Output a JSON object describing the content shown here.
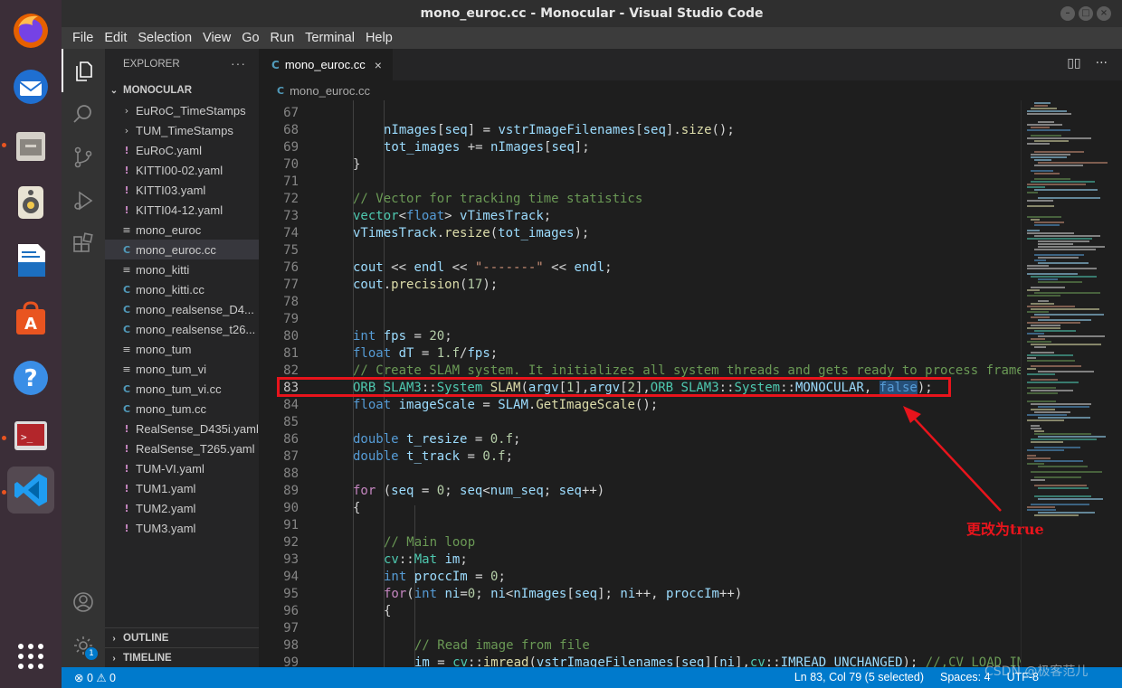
{
  "window": {
    "title": "mono_euroc.cc - Monocular - Visual Studio Code"
  },
  "menu": [
    "File",
    "Edit",
    "Selection",
    "View",
    "Go",
    "Run",
    "Terminal",
    "Help"
  ],
  "dock": {
    "apps": [
      "firefox-icon",
      "thunderbird-icon",
      "files-icon",
      "rhythmbox-icon",
      "writer-icon",
      "software-center-icon",
      "help-icon",
      "terminal-icon",
      "vscode-icon",
      "show-applications-icon"
    ]
  },
  "activity": {
    "settings_badge": "1"
  },
  "explorer": {
    "header": "EXPLORER",
    "more": "···",
    "section": "MONOCULAR",
    "files": [
      {
        "name": "EuRoC_TimeStamps",
        "kind": "folder"
      },
      {
        "name": "TUM_TimeStamps",
        "kind": "folder"
      },
      {
        "name": "EuRoC.yaml",
        "kind": "yaml"
      },
      {
        "name": "KITTI00-02.yaml",
        "kind": "yaml"
      },
      {
        "name": "KITTI03.yaml",
        "kind": "yaml"
      },
      {
        "name": "KITTI04-12.yaml",
        "kind": "yaml"
      },
      {
        "name": "mono_euroc",
        "kind": "plain"
      },
      {
        "name": "mono_euroc.cc",
        "kind": "cpp"
      },
      {
        "name": "mono_kitti",
        "kind": "plain"
      },
      {
        "name": "mono_kitti.cc",
        "kind": "cpp"
      },
      {
        "name": "mono_realsense_D4...",
        "kind": "cpp"
      },
      {
        "name": "mono_realsense_t26...",
        "kind": "cpp"
      },
      {
        "name": "mono_tum",
        "kind": "plain"
      },
      {
        "name": "mono_tum_vi",
        "kind": "plain"
      },
      {
        "name": "mono_tum_vi.cc",
        "kind": "cpp"
      },
      {
        "name": "mono_tum.cc",
        "kind": "cpp"
      },
      {
        "name": "RealSense_D435i.yaml",
        "kind": "yaml"
      },
      {
        "name": "RealSense_T265.yaml",
        "kind": "yaml"
      },
      {
        "name": "TUM-VI.yaml",
        "kind": "yaml"
      },
      {
        "name": "TUM1.yaml",
        "kind": "yaml"
      },
      {
        "name": "TUM2.yaml",
        "kind": "yaml"
      },
      {
        "name": "TUM3.yaml",
        "kind": "yaml"
      }
    ],
    "selected": "mono_euroc.cc",
    "outline": "OUTLINE",
    "timeline": "TIMELINE"
  },
  "editor": {
    "tab": "mono_euroc.cc",
    "breadcrumb": "mono_euroc.cc",
    "current_line": 83,
    "lines": [
      {
        "n": 67,
        "indent": 2,
        "tokens": []
      },
      {
        "n": 68,
        "indent": 2,
        "tokens": [
          [
            "var",
            "nImages"
          ],
          [
            "",
            "["
          ],
          [
            "var",
            "seq"
          ],
          [
            "",
            "] = "
          ],
          [
            "var",
            "vstrImageFilenames"
          ],
          [
            "",
            "["
          ],
          [
            "var",
            "seq"
          ],
          [
            "",
            "]."
          ],
          [
            "fn",
            "size"
          ],
          [
            "",
            "();"
          ]
        ]
      },
      {
        "n": 69,
        "indent": 2,
        "tokens": [
          [
            "var",
            "tot_images"
          ],
          [
            "",
            " += "
          ],
          [
            "var",
            "nImages"
          ],
          [
            "",
            "["
          ],
          [
            "var",
            "seq"
          ],
          [
            "",
            "];"
          ]
        ]
      },
      {
        "n": 70,
        "indent": 1,
        "tokens": [
          [
            "",
            "}"
          ]
        ]
      },
      {
        "n": 71,
        "indent": 1,
        "tokens": []
      },
      {
        "n": 72,
        "indent": 1,
        "tokens": [
          [
            "com",
            "// Vector for tracking time statistics"
          ]
        ]
      },
      {
        "n": 73,
        "indent": 1,
        "tokens": [
          [
            "ty",
            "vector"
          ],
          [
            "",
            "<"
          ],
          [
            "kw",
            "float"
          ],
          [
            "",
            "> "
          ],
          [
            "var",
            "vTimesTrack"
          ],
          [
            "",
            ";"
          ]
        ]
      },
      {
        "n": 74,
        "indent": 1,
        "tokens": [
          [
            "var",
            "vTimesTrack"
          ],
          [
            "",
            "."
          ],
          [
            "fn",
            "resize"
          ],
          [
            "",
            "("
          ],
          [
            "var",
            "tot_images"
          ],
          [
            "",
            ");"
          ]
        ]
      },
      {
        "n": 75,
        "indent": 1,
        "tokens": []
      },
      {
        "n": 76,
        "indent": 1,
        "tokens": [
          [
            "var",
            "cout"
          ],
          [
            "",
            " << "
          ],
          [
            "var",
            "endl"
          ],
          [
            "",
            " << "
          ],
          [
            "str",
            "\"-------\""
          ],
          [
            "",
            " << "
          ],
          [
            "var",
            "endl"
          ],
          [
            "",
            ";"
          ]
        ]
      },
      {
        "n": 77,
        "indent": 1,
        "tokens": [
          [
            "var",
            "cout"
          ],
          [
            "",
            "."
          ],
          [
            "fn",
            "precision"
          ],
          [
            "",
            "("
          ],
          [
            "num",
            "17"
          ],
          [
            "",
            ");"
          ]
        ]
      },
      {
        "n": 78,
        "indent": 1,
        "tokens": []
      },
      {
        "n": 79,
        "indent": 1,
        "tokens": []
      },
      {
        "n": 80,
        "indent": 1,
        "tokens": [
          [
            "kw",
            "int"
          ],
          [
            "",
            " "
          ],
          [
            "var",
            "fps"
          ],
          [
            "",
            " = "
          ],
          [
            "num",
            "20"
          ],
          [
            "",
            ";"
          ]
        ]
      },
      {
        "n": 81,
        "indent": 1,
        "tokens": [
          [
            "kw",
            "float"
          ],
          [
            "",
            " "
          ],
          [
            "var",
            "dT"
          ],
          [
            "",
            " = "
          ],
          [
            "num",
            "1.f"
          ],
          [
            "",
            "/"
          ],
          [
            "var",
            "fps"
          ],
          [
            "",
            ";"
          ]
        ]
      },
      {
        "n": 82,
        "indent": 1,
        "tokens": [
          [
            "com",
            "// Create SLAM system. It initializes all system threads and gets ready to process frames."
          ]
        ]
      },
      {
        "n": 83,
        "indent": 1,
        "tokens": [
          [
            "ty",
            "ORB_SLAM3"
          ],
          [
            "",
            "::"
          ],
          [
            "ty",
            "System"
          ],
          [
            "",
            " "
          ],
          [
            "fn",
            "SLAM"
          ],
          [
            "",
            "("
          ],
          [
            "var",
            "argv"
          ],
          [
            "",
            "["
          ],
          [
            "num",
            "1"
          ],
          [
            "",
            "],"
          ],
          [
            "var",
            "argv"
          ],
          [
            "",
            "["
          ],
          [
            "num",
            "2"
          ],
          [
            "",
            "],"
          ],
          [
            "ty",
            "ORB_SLAM3"
          ],
          [
            "",
            "::"
          ],
          [
            "ty",
            "System"
          ],
          [
            "",
            "::"
          ],
          [
            "var",
            "MONOCULAR"
          ],
          [
            "",
            ", "
          ],
          [
            "sel",
            "false"
          ],
          [
            "",
            ");"
          ]
        ]
      },
      {
        "n": 84,
        "indent": 1,
        "tokens": [
          [
            "kw",
            "float"
          ],
          [
            "",
            " "
          ],
          [
            "var",
            "imageScale"
          ],
          [
            "",
            " = "
          ],
          [
            "var",
            "SLAM"
          ],
          [
            "",
            "."
          ],
          [
            "fn",
            "GetImageScale"
          ],
          [
            "",
            "();"
          ]
        ]
      },
      {
        "n": 85,
        "indent": 1,
        "tokens": []
      },
      {
        "n": 86,
        "indent": 1,
        "tokens": [
          [
            "kw",
            "double"
          ],
          [
            "",
            " "
          ],
          [
            "var",
            "t_resize"
          ],
          [
            "",
            " = "
          ],
          [
            "num",
            "0.f"
          ],
          [
            "",
            ";"
          ]
        ]
      },
      {
        "n": 87,
        "indent": 1,
        "tokens": [
          [
            "kw",
            "double"
          ],
          [
            "",
            " "
          ],
          [
            "var",
            "t_track"
          ],
          [
            "",
            " = "
          ],
          [
            "num",
            "0.f"
          ],
          [
            "",
            ";"
          ]
        ]
      },
      {
        "n": 88,
        "indent": 1,
        "tokens": []
      },
      {
        "n": 89,
        "indent": 1,
        "tokens": [
          [
            "ctl",
            "for"
          ],
          [
            "",
            " ("
          ],
          [
            "var",
            "seq"
          ],
          [
            "",
            " = "
          ],
          [
            "num",
            "0"
          ],
          [
            "",
            "; "
          ],
          [
            "var",
            "seq"
          ],
          [
            "",
            "<"
          ],
          [
            "var",
            "num_seq"
          ],
          [
            "",
            "; "
          ],
          [
            "var",
            "seq"
          ],
          [
            "",
            "++)"
          ]
        ]
      },
      {
        "n": 90,
        "indent": 1,
        "tokens": [
          [
            "",
            "{"
          ]
        ]
      },
      {
        "n": 91,
        "indent": 2,
        "tokens": []
      },
      {
        "n": 92,
        "indent": 2,
        "tokens": [
          [
            "com",
            "// Main loop"
          ]
        ]
      },
      {
        "n": 93,
        "indent": 2,
        "tokens": [
          [
            "ty",
            "cv"
          ],
          [
            "",
            "::"
          ],
          [
            "ty",
            "Mat"
          ],
          [
            "",
            " "
          ],
          [
            "var",
            "im"
          ],
          [
            "",
            ";"
          ]
        ]
      },
      {
        "n": 94,
        "indent": 2,
        "tokens": [
          [
            "kw",
            "int"
          ],
          [
            "",
            " "
          ],
          [
            "var",
            "proccIm"
          ],
          [
            "",
            " = "
          ],
          [
            "num",
            "0"
          ],
          [
            "",
            ";"
          ]
        ]
      },
      {
        "n": 95,
        "indent": 2,
        "tokens": [
          [
            "ctl",
            "for"
          ],
          [
            "",
            "("
          ],
          [
            "kw",
            "int"
          ],
          [
            "",
            " "
          ],
          [
            "var",
            "ni"
          ],
          [
            "",
            "="
          ],
          [
            "num",
            "0"
          ],
          [
            "",
            "; "
          ],
          [
            "var",
            "ni"
          ],
          [
            "",
            "<"
          ],
          [
            "var",
            "nImages"
          ],
          [
            "",
            "["
          ],
          [
            "var",
            "seq"
          ],
          [
            "",
            "]; "
          ],
          [
            "var",
            "ni"
          ],
          [
            "",
            "++, "
          ],
          [
            "var",
            "proccIm"
          ],
          [
            "",
            "++)"
          ]
        ]
      },
      {
        "n": 96,
        "indent": 2,
        "tokens": [
          [
            "",
            "{"
          ]
        ]
      },
      {
        "n": 97,
        "indent": 3,
        "tokens": []
      },
      {
        "n": 98,
        "indent": 3,
        "tokens": [
          [
            "com",
            "// Read image from file"
          ]
        ]
      },
      {
        "n": 99,
        "indent": 3,
        "tokens": [
          [
            "var",
            "im"
          ],
          [
            "",
            " = "
          ],
          [
            "ty",
            "cv"
          ],
          [
            "",
            "::"
          ],
          [
            "fn",
            "imread"
          ],
          [
            "",
            "("
          ],
          [
            "var",
            "vstrImageFilenames"
          ],
          [
            "",
            "["
          ],
          [
            "var",
            "seq"
          ],
          [
            "",
            "]["
          ],
          [
            "var",
            "ni"
          ],
          [
            "",
            "],"
          ],
          [
            "ty",
            "cv"
          ],
          [
            "",
            "::"
          ],
          [
            "var",
            "IMREAD_UNCHANGED"
          ],
          [
            "",
            "); "
          ],
          [
            "com",
            "//,CV_LOAD_IMAGE_UNCHANGED);"
          ]
        ]
      }
    ]
  },
  "annotation": {
    "text": "更改为true"
  },
  "status": {
    "problems": "⊗ 0 ⚠ 0",
    "position": "Ln 83, Col 79 (5 selected)",
    "spaces": "Spaces: 4",
    "encoding": "UTF-8"
  },
  "watermark": "CSDN @极客范儿"
}
